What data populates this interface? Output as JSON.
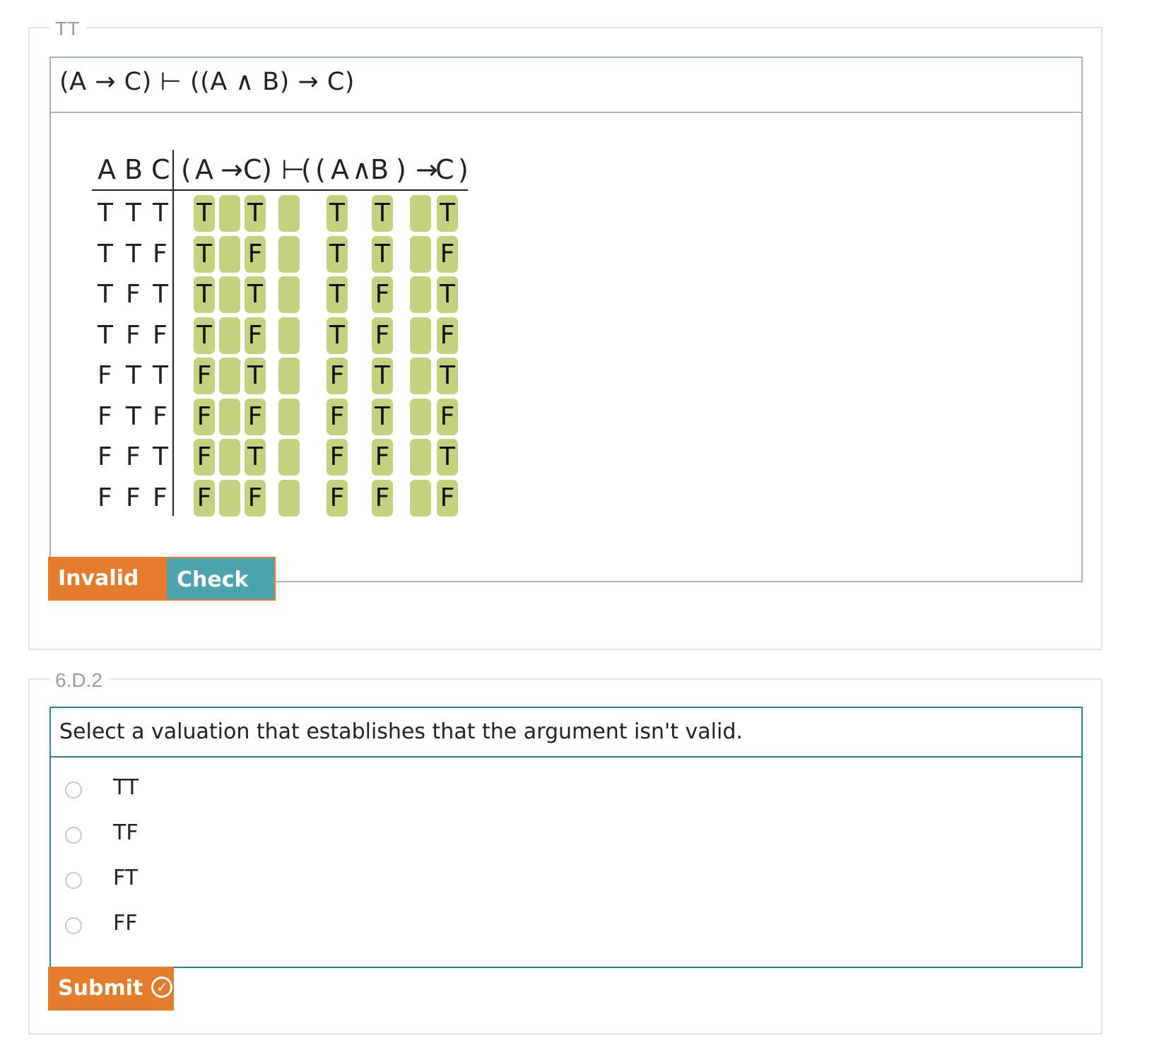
{
  "card1": {
    "tag": "TT",
    "prompt": "(A → C) ⊢ ((A ∧ B) → C)",
    "table": {
      "headers": [
        "A",
        "B",
        "C",
        "(",
        "A",
        "→",
        "C",
        ")",
        "⊢",
        "(",
        "(",
        "A",
        "∧",
        "B",
        ")",
        "→",
        "C",
        ")"
      ],
      "rows": [
        {
          "vals": [
            "T",
            "T",
            "T"
          ],
          "cells": [
            "T",
            "",
            "T",
            "",
            "T",
            "T",
            "",
            "T"
          ]
        },
        {
          "vals": [
            "T",
            "T",
            "F"
          ],
          "cells": [
            "T",
            "",
            "F",
            "",
            "T",
            "T",
            "",
            "F"
          ]
        },
        {
          "vals": [
            "T",
            "F",
            "T"
          ],
          "cells": [
            "T",
            "",
            "T",
            "",
            "T",
            "F",
            "",
            "T"
          ]
        },
        {
          "vals": [
            "T",
            "F",
            "F"
          ],
          "cells": [
            "T",
            "",
            "F",
            "",
            "T",
            "F",
            "",
            "F"
          ]
        },
        {
          "vals": [
            "F",
            "T",
            "T"
          ],
          "cells": [
            "F",
            "",
            "T",
            "",
            "F",
            "T",
            "",
            "T"
          ]
        },
        {
          "vals": [
            "F",
            "T",
            "F"
          ],
          "cells": [
            "F",
            "",
            "F",
            "",
            "F",
            "T",
            "",
            "F"
          ]
        },
        {
          "vals": [
            "F",
            "F",
            "T"
          ],
          "cells": [
            "F",
            "",
            "T",
            "",
            "F",
            "F",
            "",
            "T"
          ]
        },
        {
          "vals": [
            "F",
            "F",
            "F"
          ],
          "cells": [
            "F",
            "",
            "F",
            "",
            "F",
            "F",
            "",
            "F"
          ]
        }
      ]
    },
    "buttons": {
      "invalid_label": "Invalid",
      "invalid_icon": "!",
      "check_label": "Check",
      "check_icon": "?"
    }
  },
  "card2": {
    "tag": "6.D.2",
    "prompt": "Select a valuation that establishes that the argument isn't valid.",
    "options": [
      "TT",
      "TF",
      "FT",
      "FF"
    ],
    "submit_label": "Submit",
    "submit_icon": "✓"
  },
  "colors": {
    "accent_orange": "#e47c2d",
    "accent_teal": "#4aa3ad",
    "cell_green": "#c3d27f",
    "box_border_teal": "#2d8190"
  }
}
